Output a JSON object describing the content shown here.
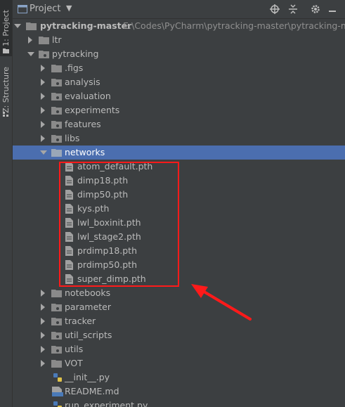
{
  "sidebar": {
    "tab_project": "1: Project",
    "tab_structure": "Z: Structure"
  },
  "header": {
    "title": "Project"
  },
  "tree": {
    "root": {
      "label": "pytracking-master",
      "path": "E:\\Codes\\PyCharm\\pytracking-master\\pytracking-maste"
    },
    "ltr": "ltr",
    "pytracking": "pytracking",
    "children": [
      ".figs",
      "analysis",
      "evaluation",
      "experiments",
      "features",
      "libs"
    ],
    "networks": "networks",
    "network_files": [
      "atom_default.pth",
      "dimp18.pth",
      "dimp50.pth",
      "kys.pth",
      "lwl_boxinit.pth",
      "lwl_stage2.pth",
      "prdimp18.pth",
      "prdimp50.pth",
      "super_dimp.pth"
    ],
    "children_after": [
      "notebooks",
      "parameter",
      "tracker",
      "util_scripts",
      "utils",
      "VOT"
    ],
    "files_after": [
      "__init__.py",
      "README.md",
      "run_experiment.py"
    ]
  },
  "colors": {
    "background": "#3c3f41",
    "selection": "#4b6eaf",
    "annotation": "#ff1a1a"
  }
}
